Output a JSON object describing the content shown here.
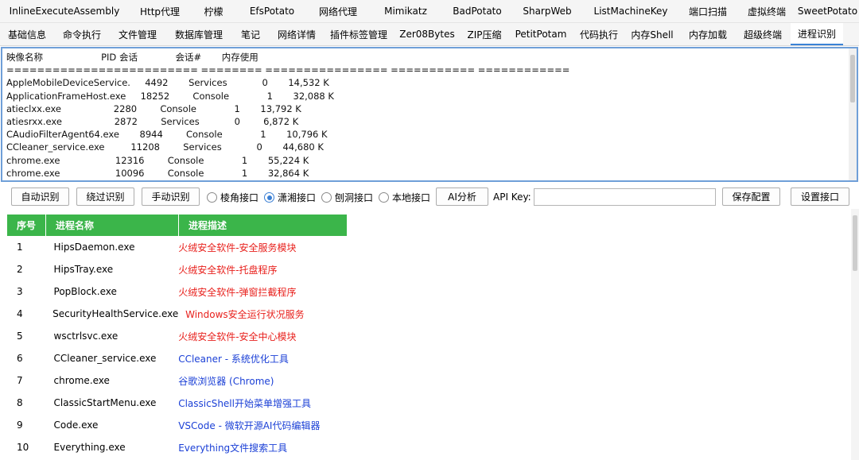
{
  "tabs_row1": [
    "InlineExecuteAssembly",
    "Http代理",
    "柠檬",
    "EfsPotato",
    "网络代理",
    "Mimikatz",
    "BadPotato",
    "SharpWeb",
    "ListMachineKey",
    "端口扫描",
    "虚拟终端",
    "SweetPotato"
  ],
  "tabs_row2": [
    "基础信息",
    "命令执行",
    "文件管理",
    "数据库管理",
    "笔记",
    "网络详情",
    "插件标签管理",
    "Zer08Bytes",
    "ZIP压缩",
    "PetitPotam",
    "代码执行",
    "内存Shell",
    "内存加载",
    "超级终端",
    "进程识别"
  ],
  "active_tab": "进程识别",
  "output": {
    "header": "映像名称                    PID 会话             会话#       内存使用",
    "separator": "========================= ======== ================ =========== ============",
    "lines": [
      "AppleMobileDeviceService.     4492       Services            0       14,532 K",
      "ApplicationFrameHost.exe     18252        Console             1       32,088 K",
      "atieclxx.exe                  2280        Console             1       13,792 K",
      "atiesrxx.exe                  2872        Services            0        6,872 K",
      "CAudioFilterAgent64.exe       8944        Console             1       10,796 K",
      "CCleaner_service.exe         11208        Services            0       44,680 K",
      "chrome.exe                   12316        Console             1       55,224 K",
      "chrome.exe                   10096        Console             1       32,864 K"
    ]
  },
  "controls": {
    "btn_auto": "自动识别",
    "btn_bypass": "绕过识别",
    "btn_manual": "手动识别",
    "radio1": "棱角接口",
    "radio2": "潇湘接口",
    "radio3": "刨洞接口",
    "radio4": "本地接口",
    "radio_selected": "潇湘接口",
    "btn_ai": "AI分析",
    "api_key_label": "API Key:",
    "api_key_value": "",
    "btn_save": "保存配置",
    "btn_setif": "设置接口"
  },
  "table": {
    "headers": [
      "序号",
      "进程名称",
      "进程描述"
    ],
    "header_color": "#3bb54a",
    "rows": [
      {
        "no": "1",
        "name": "HipsDaemon.exe",
        "desc": "火绒安全软件-安全服务模块",
        "color": "red"
      },
      {
        "no": "2",
        "name": "HipsTray.exe",
        "desc": "火绒安全软件-托盘程序",
        "color": "red"
      },
      {
        "no": "3",
        "name": "PopBlock.exe",
        "desc": "火绒安全软件-弹窗拦截程序",
        "color": "red"
      },
      {
        "no": "4",
        "name": "SecurityHealthService.exe",
        "desc": "Windows安全运行状况服务",
        "color": "red"
      },
      {
        "no": "5",
        "name": "wsctrlsvc.exe",
        "desc": "火绒安全软件-安全中心模块",
        "color": "red"
      },
      {
        "no": "6",
        "name": "CCleaner_service.exe",
        "desc": "CCleaner - 系统优化工具",
        "color": "blue"
      },
      {
        "no": "7",
        "name": "chrome.exe",
        "desc": "谷歌浏览器 (Chrome)",
        "color": "blue"
      },
      {
        "no": "8",
        "name": "ClassicStartMenu.exe",
        "desc": "ClassicShell开始菜单增强工具",
        "color": "blue"
      },
      {
        "no": "9",
        "name": "Code.exe",
        "desc": "VSCode - 微软开源AI代码编辑器",
        "color": "blue"
      },
      {
        "no": "10",
        "name": "Everything.exe",
        "desc": "Everything文件搜索工具",
        "color": "blue"
      }
    ]
  }
}
